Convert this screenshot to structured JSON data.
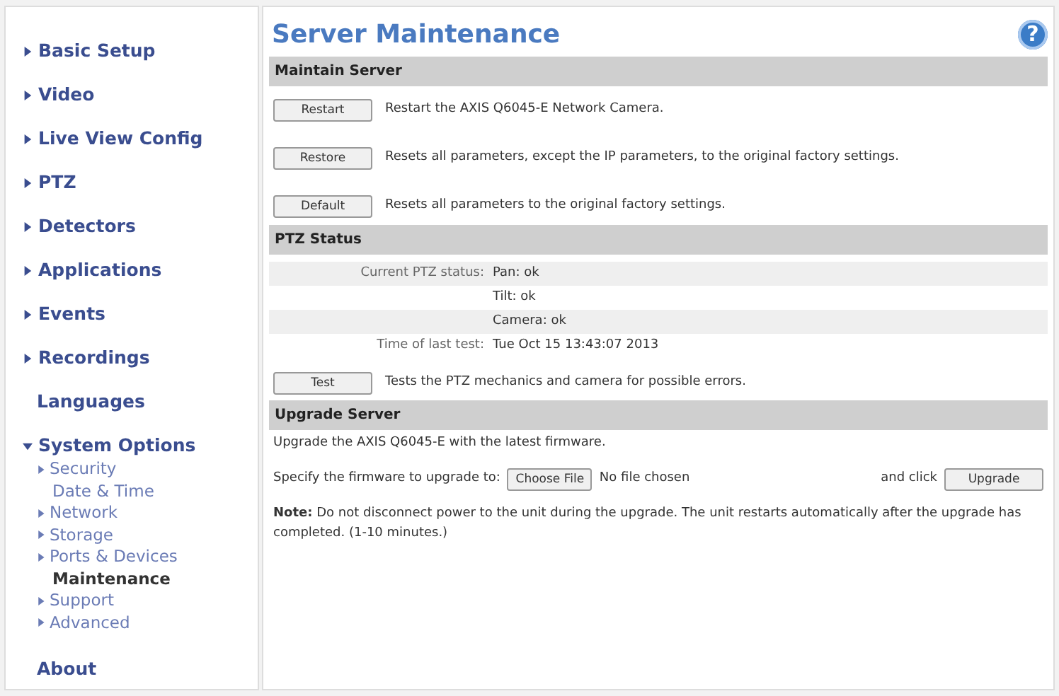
{
  "sidebar": {
    "items": [
      {
        "label": "Basic Setup",
        "kind": "collapsed"
      },
      {
        "label": "Video",
        "kind": "collapsed"
      },
      {
        "label": "Live View Config",
        "kind": "collapsed"
      },
      {
        "label": "PTZ",
        "kind": "collapsed"
      },
      {
        "label": "Detectors",
        "kind": "collapsed"
      },
      {
        "label": "Applications",
        "kind": "collapsed"
      },
      {
        "label": "Events",
        "kind": "collapsed"
      },
      {
        "label": "Recordings",
        "kind": "collapsed"
      },
      {
        "label": "Languages",
        "kind": "plain"
      },
      {
        "label": "System Options",
        "kind": "expanded",
        "children": [
          {
            "label": "Security",
            "kind": "collapsed",
            "selected": false
          },
          {
            "label": "Date & Time",
            "kind": "plain",
            "selected": false
          },
          {
            "label": "Network",
            "kind": "collapsed",
            "selected": false
          },
          {
            "label": "Storage",
            "kind": "collapsed",
            "selected": false
          },
          {
            "label": "Ports & Devices",
            "kind": "collapsed",
            "selected": false
          },
          {
            "label": "Maintenance",
            "kind": "plain",
            "selected": true
          },
          {
            "label": "Support",
            "kind": "collapsed",
            "selected": false
          },
          {
            "label": "Advanced",
            "kind": "collapsed",
            "selected": false
          }
        ]
      },
      {
        "label": "About",
        "kind": "plain"
      }
    ]
  },
  "page": {
    "title": "Server Maintenance",
    "help": "?"
  },
  "maintain_server": {
    "heading": "Maintain Server",
    "actions": [
      {
        "button": "Restart",
        "description": "Restart the AXIS Q6045-E Network Camera."
      },
      {
        "button": "Restore",
        "description": "Resets all parameters, except the IP parameters, to the original factory settings."
      },
      {
        "button": "Default",
        "description": "Resets all parameters to the original factory settings."
      }
    ]
  },
  "ptz_status": {
    "heading": "PTZ Status",
    "rows": [
      {
        "label": "Current PTZ status:",
        "value": "Pan: ok"
      },
      {
        "value": "Tilt: ok"
      },
      {
        "value": "Camera: ok"
      },
      {
        "label": "Time of last test:",
        "value": "Tue Oct 15 13:43:07 2013"
      }
    ],
    "test": {
      "button": "Test",
      "description": "Tests the PTZ mechanics and camera for possible errors."
    }
  },
  "upgrade_server": {
    "heading": "Upgrade Server",
    "intro": "Upgrade the AXIS Q6045-E with the latest firmware.",
    "specify_label": "Specify the firmware to upgrade to:",
    "choose_button": "Choose File",
    "file_status": "No file chosen",
    "click_label": "and click",
    "upgrade_button": "Upgrade",
    "note": "**Note:** Do not disconnect power to the unit during the upgrade. The unit restarts automatically after the upgrade has completed. (1-10 minutes.)"
  }
}
